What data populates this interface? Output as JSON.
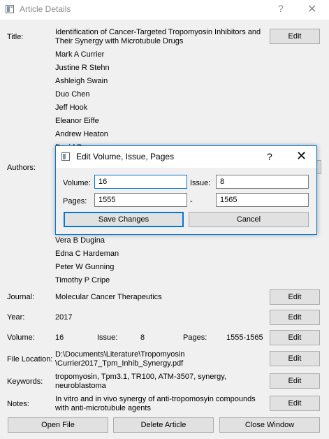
{
  "window": {
    "title": "Article Details",
    "help": "?",
    "close": "✕"
  },
  "labels": {
    "title": "Title:",
    "authors": "Authors:",
    "journal": "Journal:",
    "year": "Year:",
    "volume": "Volume:",
    "file_location": "File Location:",
    "keywords": "Keywords:",
    "notes": "Notes:",
    "issue_inline": "Issue:",
    "pages_inline": "Pages:"
  },
  "article": {
    "title_line1": "Identification of Cancer-Targeted Tropomyosin Inhibitors and",
    "title_line2": "Their Synergy with Microtubule Drugs",
    "authors_top": [
      "Mark A Currier",
      "Justine R Stehn",
      "Ashleigh Swain",
      "Duo Chen",
      "Jeff Hook",
      "Eleanor Eiffe",
      "Andrew Heaton"
    ],
    "authors_partial": "David Brown",
    "authors_bottom": [
      "Vera B Dugina",
      "Edna C Hardeman",
      "Peter W Gunning",
      "Timothy P Cripe"
    ],
    "journal": "Molecular Cancer Therapeutics",
    "year": "2017",
    "volume": "16",
    "issue": "8",
    "pages": "1555-1565",
    "file_line1": "D:\\Documents\\Literature\\Tropomyosin",
    "file_line2": "\\Currier2017_Tpm_Inhib_Synergy.pdf",
    "keywords_line1": "tropomyosin, Tpm3.1, TR100, ATM-3507, synergy,",
    "keywords_line2": "neuroblastoma",
    "notes_line1": "In vitro and in vivo synergy of anti-tropomosyin compounds",
    "notes_line2": "with anti-microtubule agents"
  },
  "buttons": {
    "edit": "Edit",
    "open_file": "Open File",
    "delete_article": "Delete Article",
    "close_window": "Close Window"
  },
  "dialog": {
    "title": "Edit Volume, Issue, Pages",
    "help": "?",
    "close": "✕",
    "volume_label": "Volume:",
    "volume_value": "16",
    "issue_label": "Issue:",
    "issue_value": "8",
    "pages_label": "Pages:",
    "pages_start": "1555",
    "pages_separator": "-",
    "pages_end": "1565",
    "save_label": "Save Changes",
    "cancel_label": "Cancel"
  },
  "icons": {
    "window_icon": "window-icon",
    "help": "help-icon",
    "close": "close-icon"
  }
}
